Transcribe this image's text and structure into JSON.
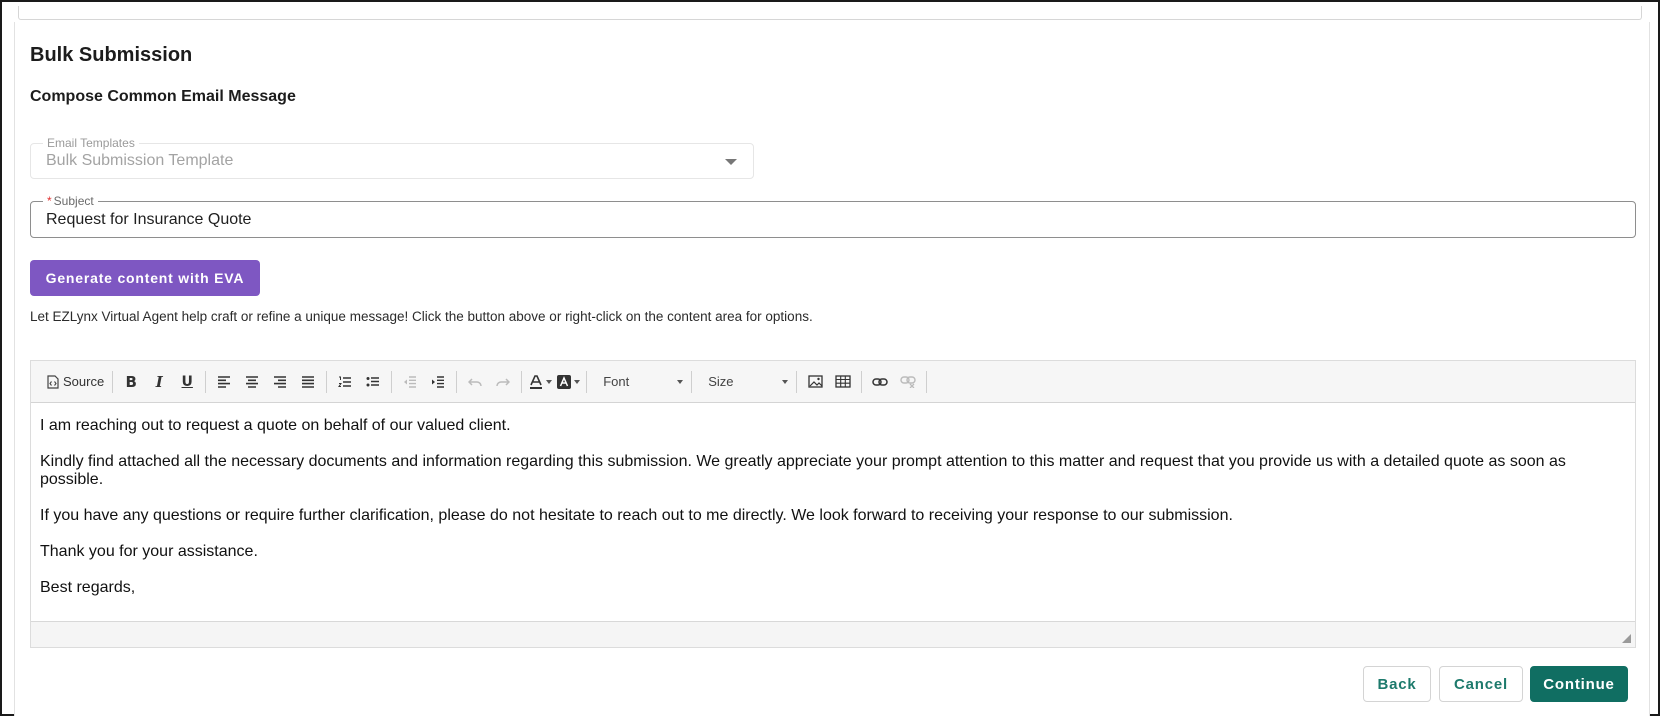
{
  "page": {
    "title": "Bulk Submission",
    "subtitle": "Compose Common Email Message"
  },
  "email_templates": {
    "label": "Email Templates",
    "value": "Bulk Submission Template"
  },
  "subject": {
    "required_mark": "*",
    "label": "Subject",
    "value": "Request for Insurance Quote"
  },
  "eva": {
    "button_label": "Generate content with EVA",
    "helper_text": "Let EZLynx Virtual Agent help craft or refine a unique message! Click the button above or right-click on the content area for options."
  },
  "editor": {
    "toolbar": {
      "source_label": "Source",
      "bold_glyph": "B",
      "italic_glyph": "I",
      "underline_glyph": "U",
      "font_label": "Font",
      "size_label": "Size"
    },
    "paragraphs": [
      "I am reaching out to request a quote on behalf of our valued client.",
      "Kindly find attached all the necessary documents and information regarding this submission. We greatly appreciate your prompt attention to this matter and request that you provide us with a detailed quote as soon as possible.",
      "If you have any questions or require further clarification, please do not hesitate to reach out to me directly. We look forward to receiving your response to our submission.",
      "Thank you for your assistance.",
      "Best regards,"
    ]
  },
  "footer": {
    "back_label": "Back",
    "cancel_label": "Cancel",
    "continue_label": "Continue"
  },
  "colors": {
    "eva_purple": "#7e57c2",
    "primary_teal": "#106e62",
    "required_red": "#e03131"
  }
}
